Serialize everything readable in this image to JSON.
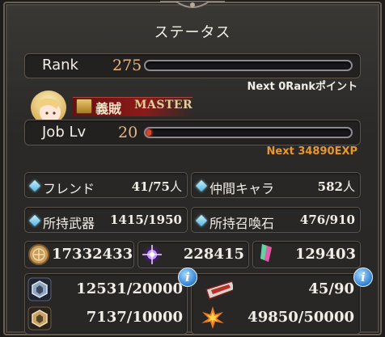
{
  "title": "ステータス",
  "rank": {
    "label": "Rank",
    "value": "275",
    "next": "Next 0Rankポイント",
    "progress": 0
  },
  "job": {
    "name": "義賊",
    "master_label": "MASTER",
    "label": "Job Lv",
    "value": "20",
    "next": "Next 34890EXP",
    "progress": 0
  },
  "stats": [
    {
      "label": "フレンド",
      "value": "41/75",
      "unit": "人"
    },
    {
      "label": "仲間キャラ",
      "value": "582",
      "unit": "人"
    },
    {
      "label": "所持武器",
      "value": "1415/1950",
      "unit": ""
    },
    {
      "label": "所持召喚石",
      "value": "476/910",
      "unit": ""
    }
  ],
  "currencies": [
    {
      "icon": "rupie-coin-icon",
      "value": "17332433"
    },
    {
      "icon": "crystal-orb-icon",
      "value": "228415"
    },
    {
      "icon": "rainbow-prism-icon",
      "value": "129403"
    }
  ],
  "items": [
    {
      "icon": "silver-shield-icon",
      "value": "12531/20000"
    },
    {
      "icon": "ticket-icon",
      "value": "45/90"
    },
    {
      "icon": "gold-shield-icon",
      "value": "7137/10000"
    },
    {
      "icon": "explosion-star-icon",
      "value": "49850/50000"
    }
  ],
  "colors": {
    "accent_orange": "#e7b783",
    "next_rank": "#f2ede6",
    "next_exp": "#e8962e",
    "info_blue": "#2f7fd0"
  }
}
